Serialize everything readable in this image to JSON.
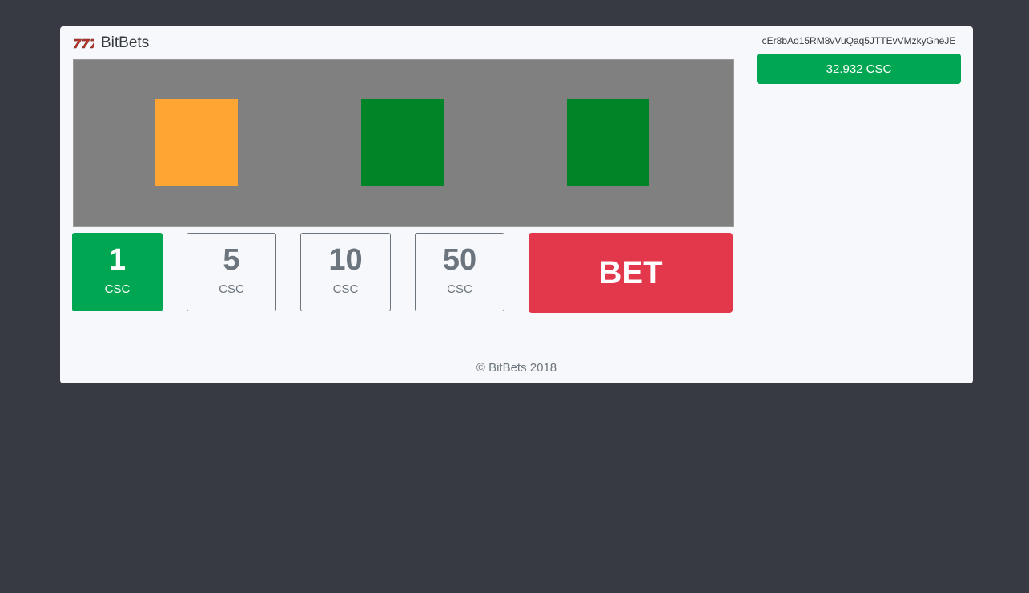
{
  "header": {
    "app_name": "BitBets",
    "logo_icon": "slot-777-icon"
  },
  "wallet": {
    "address": "cEr8bAo15RM8vVuQaq5JTTEvVMzkyGneJE",
    "balance": "32.932 CSC"
  },
  "reels": [
    {
      "color": "#ffa534"
    },
    {
      "color": "#008428"
    },
    {
      "color": "#008428"
    }
  ],
  "bet_amounts": [
    {
      "value": "1",
      "unit": "CSC",
      "selected": true
    },
    {
      "value": "5",
      "unit": "CSC",
      "selected": false
    },
    {
      "value": "10",
      "unit": "CSC",
      "selected": false
    },
    {
      "value": "50",
      "unit": "CSC",
      "selected": false
    }
  ],
  "bet_button": {
    "label": "BET"
  },
  "footer": {
    "text": "© BitBets 2018"
  },
  "colors": {
    "background": "#373a43",
    "panel": "#f7f8fb",
    "accent_green": "#00a651",
    "bet_red": "#e3374b",
    "reel_area": "#808080"
  }
}
